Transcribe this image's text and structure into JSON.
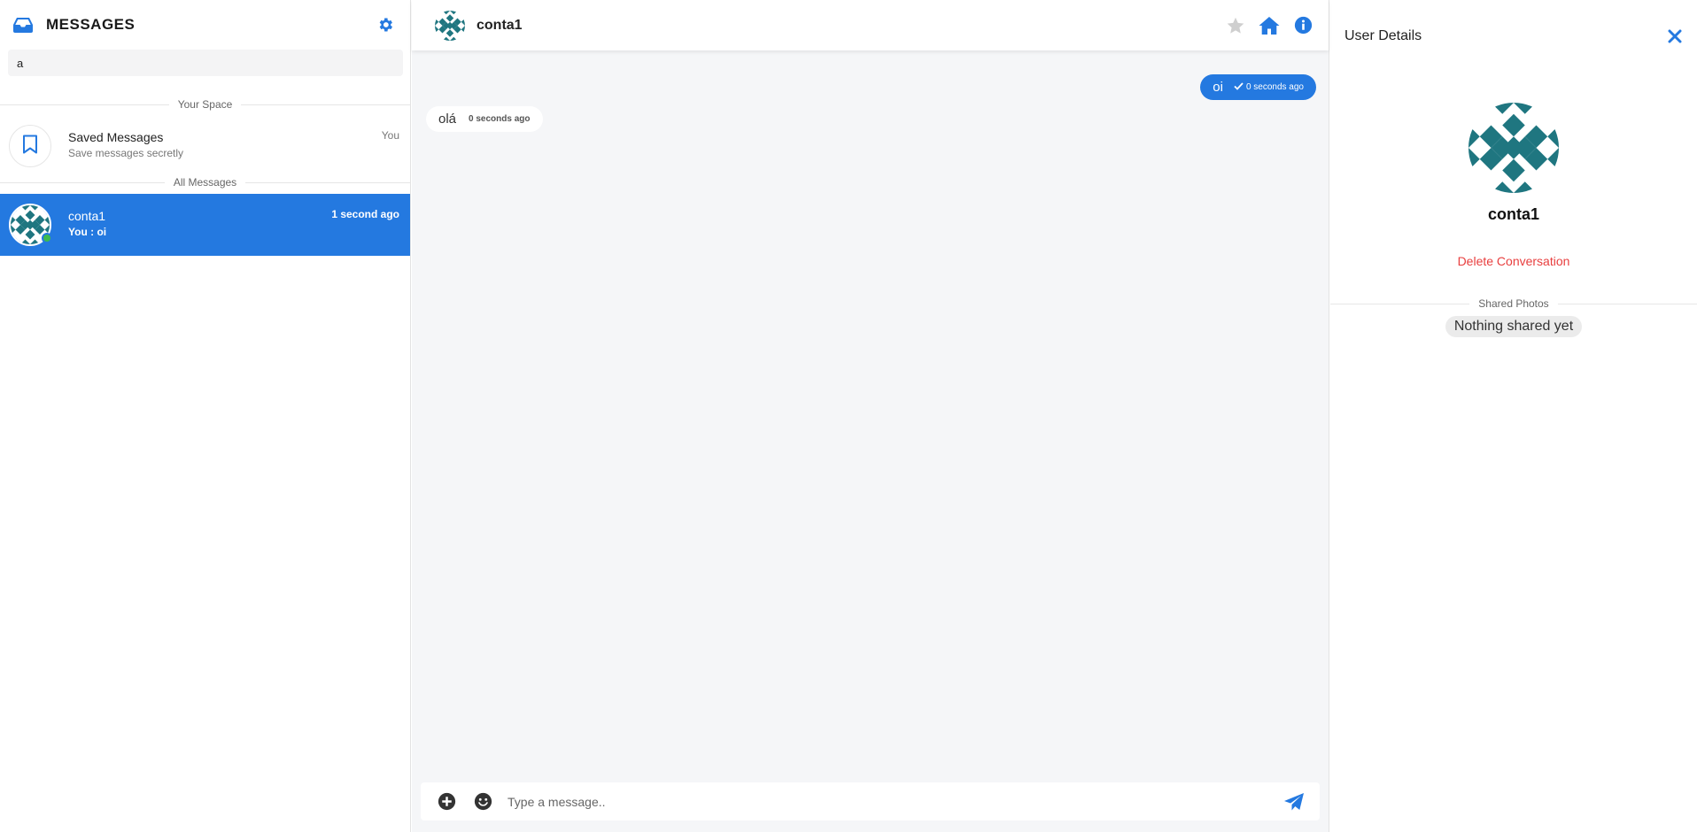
{
  "sidebar": {
    "title": "MESSAGES",
    "search_value": "a",
    "section_your_space": "Your Space",
    "section_all_messages": "All Messages",
    "saved": {
      "name": "Saved Messages",
      "subtitle": "Save messages secretly",
      "time": "You"
    },
    "conversations": [
      {
        "name": "conta1",
        "preview": "You : oi",
        "time": "1 second ago",
        "active": true,
        "online": true
      }
    ]
  },
  "chat": {
    "contact_name": "conta1",
    "messages": [
      {
        "direction": "out",
        "text": "oi",
        "time": "0 seconds ago",
        "seen": true
      },
      {
        "direction": "in",
        "text": "olá",
        "time": "0 seconds ago"
      }
    ],
    "composer_placeholder": "Type a message.."
  },
  "details": {
    "title": "User Details",
    "name": "conta1",
    "delete_label": "Delete Conversation",
    "shared_photos_label": "Shared Photos",
    "shared_empty": "Nothing shared yet"
  },
  "colors": {
    "accent": "#2479e0",
    "danger": "#e83e3e",
    "online": "#3dbb4e",
    "avatar_teal": "#1f7680"
  }
}
